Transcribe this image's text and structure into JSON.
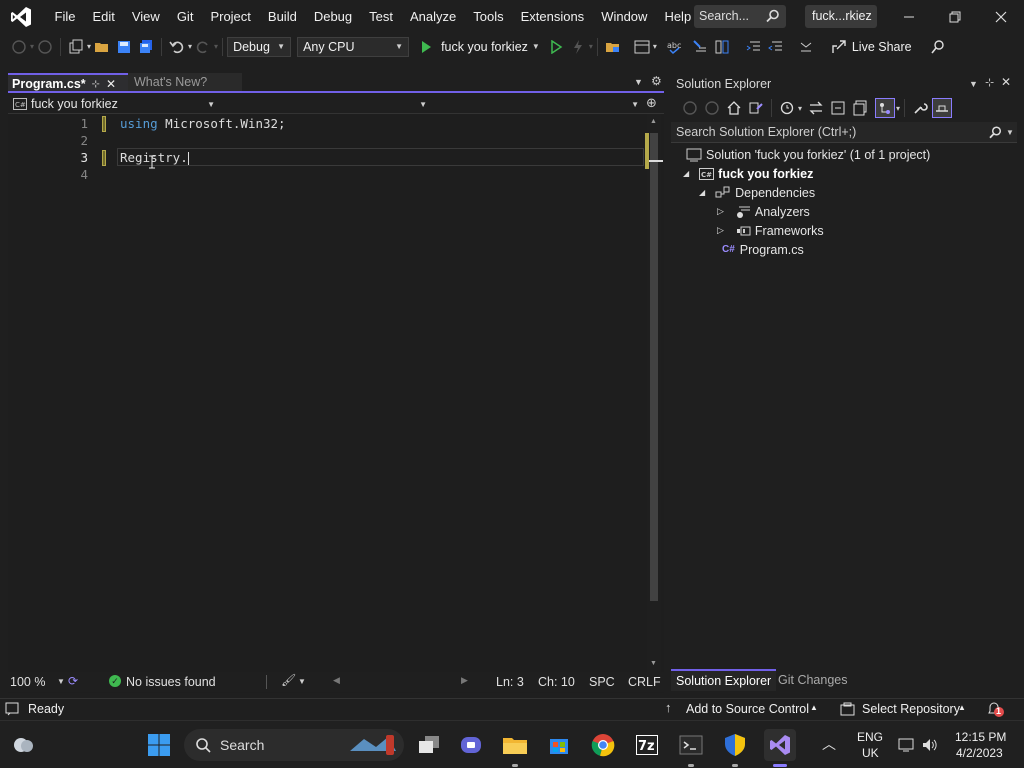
{
  "menubar": {
    "items": [
      "File",
      "Edit",
      "View",
      "Git",
      "Project",
      "Build",
      "Debug",
      "Test",
      "Analyze",
      "Tools",
      "Extensions",
      "Window",
      "Help"
    ],
    "search_label": "Search...",
    "title_badge": "fuck...rkiez",
    "window_buttons": [
      "minimize-icon",
      "restore-icon",
      "close-icon"
    ]
  },
  "toolbar": {
    "config": "Debug",
    "platform": "Any CPU",
    "run_target": "fuck you forkiez",
    "live_share": "Live Share"
  },
  "tabs": [
    {
      "label": "Program.cs*",
      "active": true
    },
    {
      "label": "What's New?",
      "active": false
    }
  ],
  "navbar": {
    "project": "fuck you forkiez"
  },
  "editor": {
    "lines": [
      {
        "n": "1",
        "kw": "using",
        "text": " Microsoft.Win32;"
      },
      {
        "n": "2",
        "kw": "",
        "text": ""
      },
      {
        "n": "3",
        "kw": "",
        "text": "Registry."
      },
      {
        "n": "4",
        "kw": "",
        "text": ""
      }
    ],
    "current_line": "3"
  },
  "editor_status": {
    "zoom": "100 %",
    "issues": "No issues found",
    "ln": "Ln: 3",
    "ch": "Ch: 10",
    "spc": "SPC",
    "crlf": "CRLF"
  },
  "solution_explorer": {
    "title": "Solution Explorer",
    "search_placeholder": "Search Solution Explorer (Ctrl+;)",
    "tree": {
      "solution": "Solution 'fuck you forkiez' (1 of 1 project)",
      "project": "fuck you forkiez",
      "dependencies": "Dependencies",
      "analyzers": "Analyzers",
      "frameworks": "Frameworks",
      "program": "Program.cs"
    },
    "bottom_tabs": [
      "Solution Explorer",
      "Git Changes"
    ]
  },
  "statusbar": {
    "ready": "Ready",
    "add_source": "Add to Source Control",
    "select_repo": "Select Repository",
    "notif_count": "1"
  },
  "taskbar": {
    "search": "Search",
    "lang": "ENG",
    "region": "UK",
    "time": "12:15 PM",
    "date": "4/2/2023"
  },
  "colors": {
    "accent": "#7160e8",
    "keyword": "#569cd6",
    "run_green": "#3fb950"
  }
}
